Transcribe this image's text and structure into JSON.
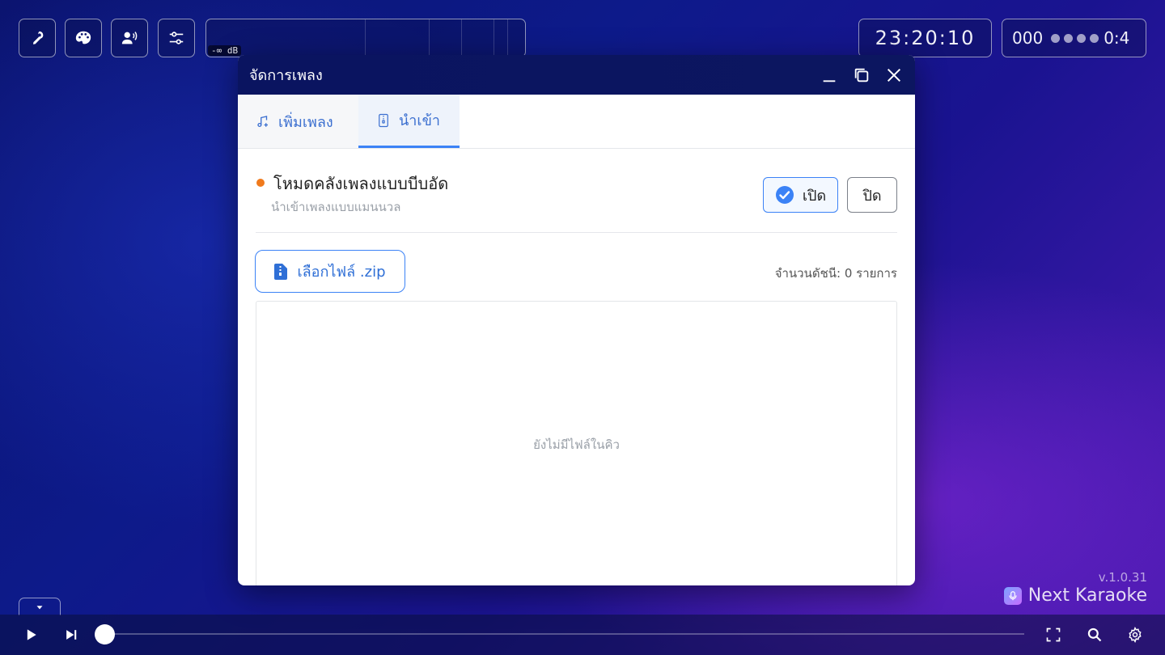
{
  "toolbar": {
    "buttons": [
      {
        "name": "microphone-icon"
      },
      {
        "name": "palette-icon"
      },
      {
        "name": "voice-icon"
      },
      {
        "name": "sliders-icon"
      }
    ],
    "level_meter": {
      "db_label": "-∞ dB"
    },
    "clock": "23:20:10",
    "counter": {
      "value": "000",
      "time": "0:4"
    }
  },
  "modal": {
    "title": "จัดการเพลง",
    "tabs": [
      {
        "label": "เพิ่มเพลง",
        "icon": "music-add-icon",
        "active": false
      },
      {
        "label": "นำเข้า",
        "icon": "zip-file-icon",
        "active": true
      }
    ],
    "mode": {
      "title": "โหมดคลังเพลงแบบบีบอัด",
      "subtitle": "นำเข้าเพลงแบบแมนนวล",
      "on_label": "เปิด",
      "off_label": "ปิด",
      "selected": "on"
    },
    "zip_button": "เลือกไฟล์ .zip",
    "index_count": "จำนวนดัชนี: 0 รายการ",
    "queue_empty": "ยังไม่มีไฟล์ในคิว"
  },
  "brand": {
    "version": "v.1.0.31",
    "name": "Next Karaoke"
  },
  "playback": {
    "progress": 0
  },
  "colors": {
    "accent": "#3b82f6",
    "status_dot": "#f07a1c",
    "header": "#0a1460"
  }
}
